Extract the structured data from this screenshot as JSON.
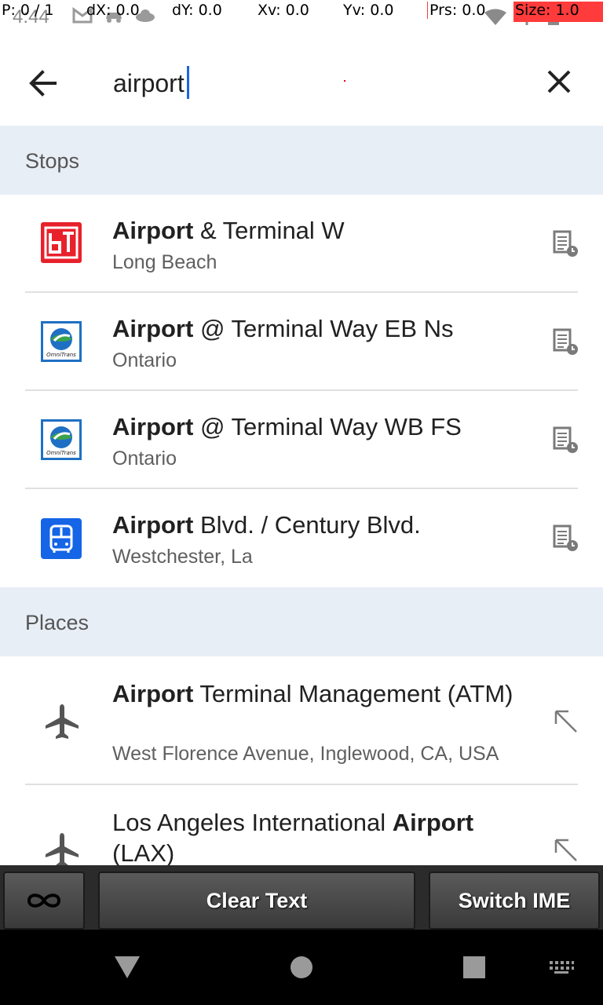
{
  "status_bar": {
    "time": "4:44",
    "overlay": {
      "p": "P: 0 / 1",
      "dx": "dX: 0.0",
      "dy": "dY: 0.0",
      "xv": "Xv: 0.0",
      "yv": "Yv: 0.0",
      "prs": "Prs: 0.0",
      "size": "Size: 1.0"
    }
  },
  "search": {
    "value": "airport",
    "back_icon": "arrow-left-icon",
    "clear_icon": "close-icon"
  },
  "sections": {
    "stops": {
      "title": "Stops",
      "items": [
        {
          "bold": "Airport",
          "rest": " & Terminal W",
          "subtitle": "Long Beach",
          "agency_icon": "long-beach-transit-logo"
        },
        {
          "bold": "Airport",
          "rest": " @ Terminal Way EB Ns",
          "subtitle": "Ontario",
          "agency_icon": "omnitrans-logo"
        },
        {
          "bold": "Airport",
          "rest": " @ Terminal Way WB FS",
          "subtitle": "Ontario",
          "agency_icon": "omnitrans-logo"
        },
        {
          "bold": "Airport",
          "rest": " Blvd. / Century Blvd.",
          "subtitle": "Westchester, La",
          "agency_icon": "bus-icon"
        }
      ]
    },
    "places": {
      "title": "Places",
      "items": [
        {
          "pre": "",
          "bold": "Airport",
          "rest": " Terminal Management (ATM)",
          "subtitle": "West Florence Avenue, Inglewood, CA, USA",
          "icon": "airplane-icon"
        },
        {
          "pre": "Los Angeles International ",
          "bold": "Airport",
          "rest": " (LAX)",
          "subtitle": "",
          "icon": "airplane-icon"
        }
      ]
    }
  },
  "omnitrans_label": "OmniTrans",
  "control_bar": {
    "clear_text": "Clear Text",
    "switch_ime": "Switch IME"
  },
  "colors": {
    "accent": "#1a66e0",
    "section_bg": "#e8eef6",
    "lbt_red": "#e8212b",
    "bus_blue": "#1565e6"
  }
}
